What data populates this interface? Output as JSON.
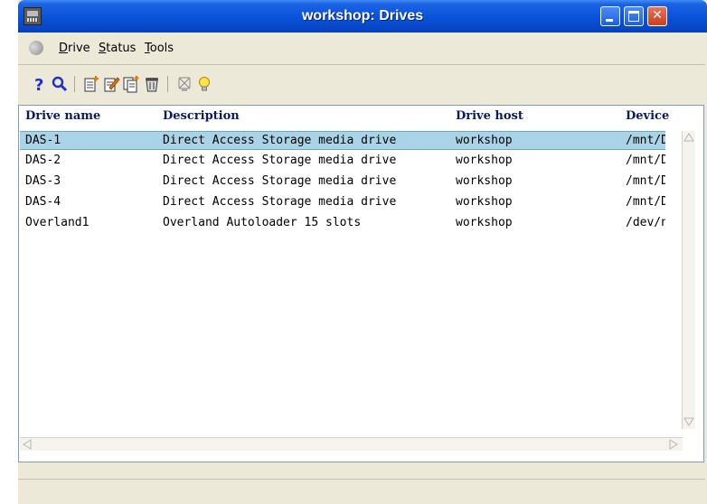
{
  "window": {
    "title": "workshop: Drives"
  },
  "menu": {
    "items": [
      {
        "label": "Drive"
      },
      {
        "label": "Status"
      },
      {
        "label": "Tools"
      }
    ]
  },
  "toolbar": {
    "icons": [
      "help-icon",
      "search-icon",
      "new-drive-icon",
      "edit-drive-icon",
      "copy-drive-icon",
      "delete-icon",
      "unavailable-icon",
      "hint-bulb-icon"
    ]
  },
  "table": {
    "columns": [
      "Drive name",
      "Description",
      "Drive host",
      "Device"
    ],
    "rows": [
      {
        "name": "DAS-1",
        "description": "Direct Access Storage media drive",
        "host": "workshop",
        "device": "/mnt/D",
        "selected": true
      },
      {
        "name": "DAS-2",
        "description": "Direct Access Storage media drive",
        "host": "workshop",
        "device": "/mnt/D",
        "selected": false
      },
      {
        "name": "DAS-3",
        "description": "Direct Access Storage media drive",
        "host": "workshop",
        "device": "/mnt/D",
        "selected": false
      },
      {
        "name": "DAS-4",
        "description": "Direct Access Storage media drive",
        "host": "workshop",
        "device": "/mnt/D",
        "selected": false
      },
      {
        "name": "Overland1",
        "description": "Overland Autoloader 15 slots",
        "host": "workshop",
        "device": "/dev/n",
        "selected": false
      }
    ]
  },
  "status": {
    "text": ""
  },
  "colors": {
    "titlebar": "#0a54dc",
    "selection": "#a9d4e8",
    "header_text": "#0a1b60",
    "chrome": "#ece9d8"
  }
}
